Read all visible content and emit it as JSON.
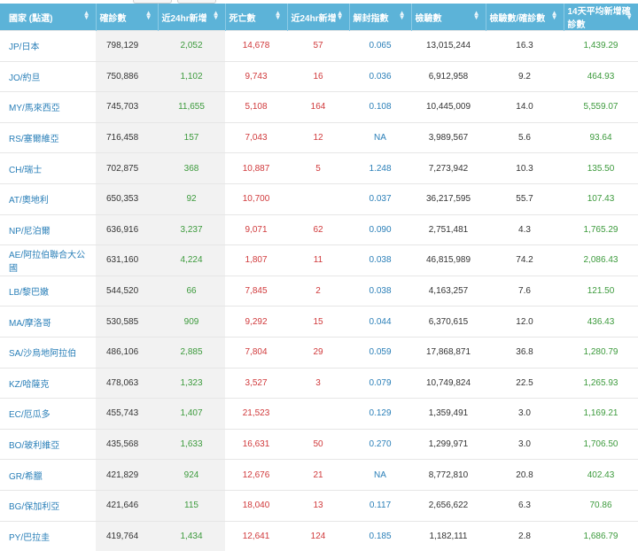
{
  "columns": [
    {
      "key": "country",
      "label": "國家 (點選)"
    },
    {
      "key": "cases",
      "label": "確診數"
    },
    {
      "key": "new",
      "label": "近24hr新增"
    },
    {
      "key": "deaths",
      "label": "死亡數"
    },
    {
      "key": "newd",
      "label": "近24hr新增"
    },
    {
      "key": "index",
      "label": "解封指數"
    },
    {
      "key": "tests",
      "label": "檢驗數"
    },
    {
      "key": "ratio",
      "label": "檢驗數/確診數"
    },
    {
      "key": "avg",
      "label": "14天平均新增確診數"
    }
  ],
  "rows": [
    {
      "country": "JP/日本",
      "cases": "798,129",
      "new": "2,052",
      "deaths": "14,678",
      "newd": "57",
      "index": "0.065",
      "tests": "13,015,244",
      "ratio": "16.3",
      "avg": "1,439.29"
    },
    {
      "country": "JO/約旦",
      "cases": "750,886",
      "new": "1,102",
      "deaths": "9,743",
      "newd": "16",
      "index": "0.036",
      "tests": "6,912,958",
      "ratio": "9.2",
      "avg": "464.93"
    },
    {
      "country": "MY/馬來西亞",
      "cases": "745,703",
      "new": "11,655",
      "deaths": "5,108",
      "newd": "164",
      "index": "0.108",
      "tests": "10,445,009",
      "ratio": "14.0",
      "avg": "5,559.07"
    },
    {
      "country": "RS/塞爾維亞",
      "cases": "716,458",
      "new": "157",
      "deaths": "7,043",
      "newd": "12",
      "index": "NA",
      "tests": "3,989,567",
      "ratio": "5.6",
      "avg": "93.64"
    },
    {
      "country": "CH/瑞士",
      "cases": "702,875",
      "new": "368",
      "deaths": "10,887",
      "newd": "5",
      "index": "1.248",
      "tests": "7,273,942",
      "ratio": "10.3",
      "avg": "135.50"
    },
    {
      "country": "AT/奧地利",
      "cases": "650,353",
      "new": "92",
      "deaths": "10,700",
      "newd": "",
      "index": "0.037",
      "tests": "36,217,595",
      "ratio": "55.7",
      "avg": "107.43"
    },
    {
      "country": "NP/尼泊爾",
      "cases": "636,916",
      "new": "3,237",
      "deaths": "9,071",
      "newd": "62",
      "index": "0.090",
      "tests": "2,751,481",
      "ratio": "4.3",
      "avg": "1,765.29"
    },
    {
      "country": "AE/阿拉伯聯合大公國",
      "cases": "631,160",
      "new": "4,224",
      "deaths": "1,807",
      "newd": "11",
      "index": "0.038",
      "tests": "46,815,989",
      "ratio": "74.2",
      "avg": "2,086.43"
    },
    {
      "country": "LB/黎巴嫩",
      "cases": "544,520",
      "new": "66",
      "deaths": "7,845",
      "newd": "2",
      "index": "0.038",
      "tests": "4,163,257",
      "ratio": "7.6",
      "avg": "121.50"
    },
    {
      "country": "MA/摩洛哥",
      "cases": "530,585",
      "new": "909",
      "deaths": "9,292",
      "newd": "15",
      "index": "0.044",
      "tests": "6,370,615",
      "ratio": "12.0",
      "avg": "436.43"
    },
    {
      "country": "SA/沙烏地阿拉伯",
      "cases": "486,106",
      "new": "2,885",
      "deaths": "7,804",
      "newd": "29",
      "index": "0.059",
      "tests": "17,868,871",
      "ratio": "36.8",
      "avg": "1,280.79"
    },
    {
      "country": "KZ/哈薩克",
      "cases": "478,063",
      "new": "1,323",
      "deaths": "3,527",
      "newd": "3",
      "index": "0.079",
      "tests": "10,749,824",
      "ratio": "22.5",
      "avg": "1,265.93"
    },
    {
      "country": "EC/厄瓜多",
      "cases": "455,743",
      "new": "1,407",
      "deaths": "21,523",
      "newd": "",
      "index": "0.129",
      "tests": "1,359,491",
      "ratio": "3.0",
      "avg": "1,169.21"
    },
    {
      "country": "BO/玻利維亞",
      "cases": "435,568",
      "new": "1,633",
      "deaths": "16,631",
      "newd": "50",
      "index": "0.270",
      "tests": "1,299,971",
      "ratio": "3.0",
      "avg": "1,706.50"
    },
    {
      "country": "GR/希臘",
      "cases": "421,829",
      "new": "924",
      "deaths": "12,676",
      "newd": "21",
      "index": "NA",
      "tests": "8,772,810",
      "ratio": "20.8",
      "avg": "402.43"
    },
    {
      "country": "BG/保加利亞",
      "cases": "421,646",
      "new": "115",
      "deaths": "18,040",
      "newd": "13",
      "index": "0.117",
      "tests": "2,656,622",
      "ratio": "6.3",
      "avg": "70.86"
    },
    {
      "country": "PY/巴拉圭",
      "cases": "419,764",
      "new": "1,434",
      "deaths": "12,641",
      "newd": "124",
      "index": "0.185",
      "tests": "1,182,111",
      "ratio": "2.8",
      "avg": "1,686.79"
    }
  ]
}
